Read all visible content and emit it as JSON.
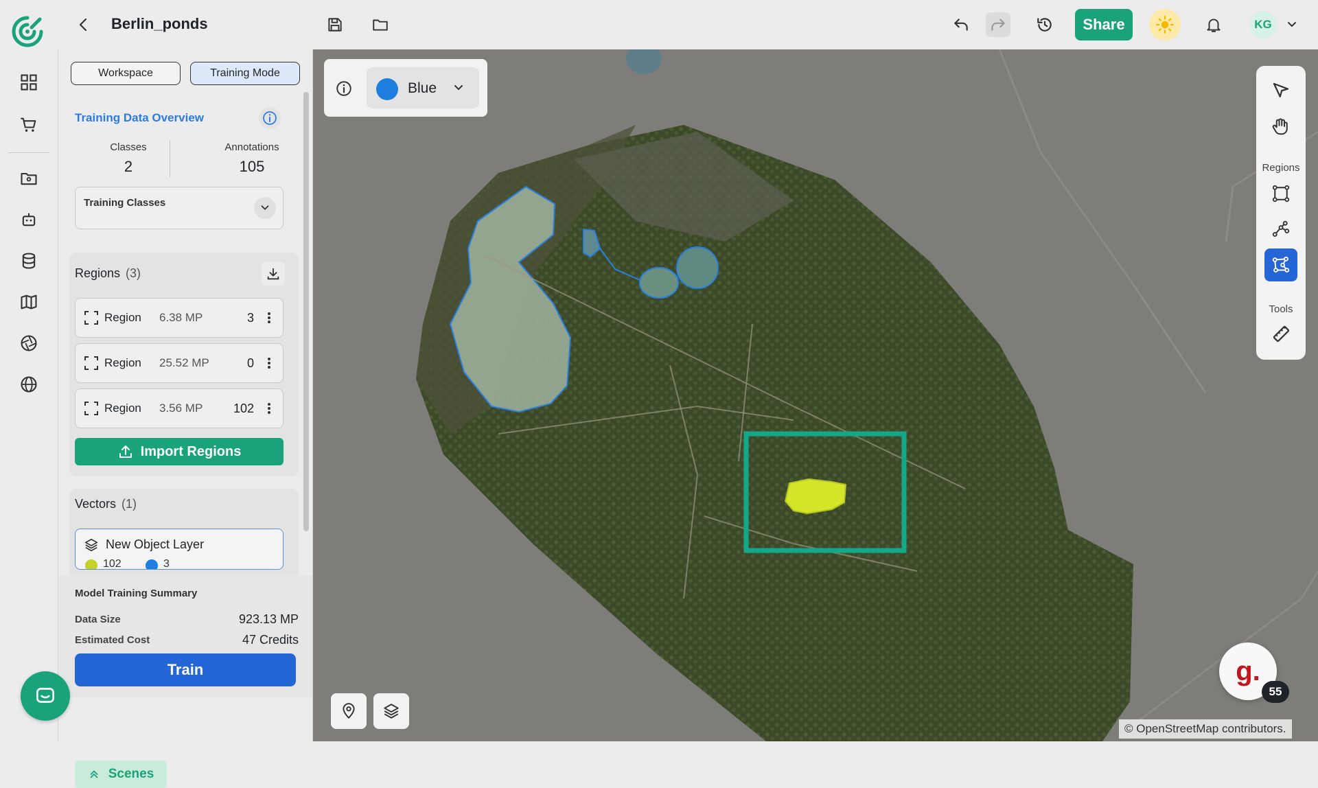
{
  "header": {
    "project_title": "Berlin_ponds",
    "share_label": "Share",
    "user_initials": "KG"
  },
  "panel": {
    "mode_tabs": [
      {
        "label": "Workspace",
        "active": false
      },
      {
        "label": "Training Mode",
        "active": true
      }
    ],
    "overview": {
      "title": "Training Data Overview",
      "classes_label": "Classes",
      "classes_value": "2",
      "annotations_label": "Annotations",
      "annotations_value": "105",
      "training_classes_label": "Training Classes"
    },
    "regions": {
      "title": "Regions",
      "count": "(3)",
      "items": [
        {
          "name": "Region",
          "size": "6.38 MP",
          "count": "3"
        },
        {
          "name": "Region",
          "size": "25.52 MP",
          "count": "0"
        },
        {
          "name": "Region",
          "size": "3.56 MP",
          "count": "102"
        }
      ],
      "import_label": "Import Regions"
    },
    "vectors": {
      "title": "Vectors",
      "count": "(1)",
      "layer_name": "New Object Layer",
      "class_counts": [
        {
          "count": "102",
          "color": "#c2d227"
        },
        {
          "count": "3",
          "color": "#1f7fe0"
        }
      ]
    },
    "summary": {
      "title": "Model Training Summary",
      "data_size_label": "Data Size",
      "data_size_value": "923.13 MP",
      "cost_label": "Estimated Cost",
      "cost_value": "47 Credits",
      "train_label": "Train"
    },
    "scenes_label": "Scenes"
  },
  "map": {
    "color_selector": {
      "label": "Blue",
      "color": "#1f7fe0"
    },
    "toolbar": {
      "regions_label": "Regions",
      "tools_label": "Tools"
    },
    "badge_count": "55",
    "attribution": "© OpenStreetMap contributors."
  },
  "colors": {
    "accent_green": "#1aa37a",
    "accent_blue": "#2466d6",
    "highlight_box": "#14a88a"
  }
}
